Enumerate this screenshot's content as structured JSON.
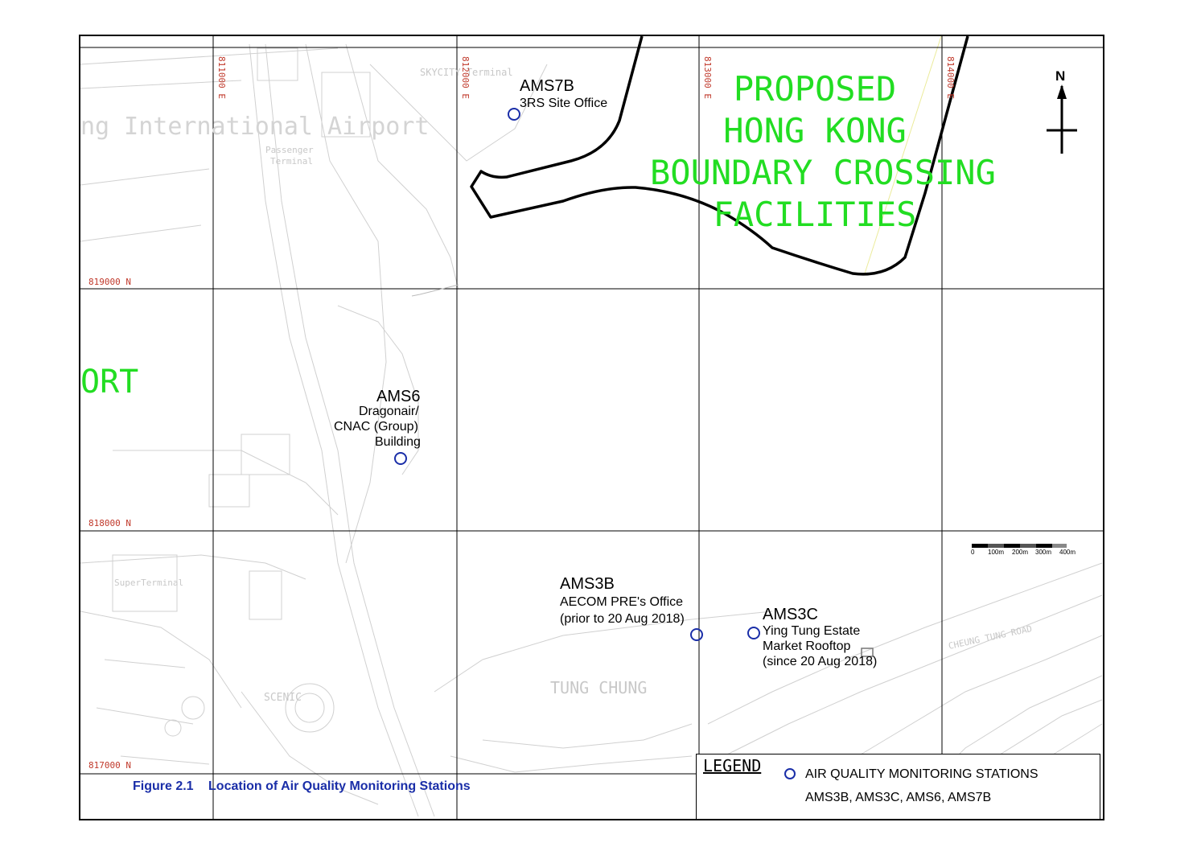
{
  "map": {
    "proposed_area": {
      "lines": [
        "PROPOSED",
        "HONG KONG",
        "BOUNDARY CROSSING",
        "FACILITIES"
      ]
    },
    "airport_fragment": "ORT",
    "north_arrow": {
      "label": "N",
      "icon": "north-arrow-icon"
    },
    "grid": {
      "eastings": [
        "811000 E",
        "812000 E",
        "813000 E",
        "814000 E"
      ],
      "northings": [
        "819000 N",
        "818000 N",
        "817000 N"
      ]
    },
    "stations": [
      {
        "id": "AMS7B",
        "name": "AMS7B",
        "desc": [
          "3RS Site Office"
        ]
      },
      {
        "id": "AMS6",
        "name": "AMS6",
        "desc": [
          "Dragonair/",
          "CNAC (Group)",
          "Building"
        ]
      },
      {
        "id": "AMS3B",
        "name": "AMS3B",
        "desc": [
          "AECOM PRE's Office",
          "(prior to 20 Aug 2018)"
        ]
      },
      {
        "id": "AMS3C",
        "name": "AMS3C",
        "desc": [
          "Ying Tung Estate",
          "Market Rooftop",
          "(since 20 Aug 2018)"
        ]
      }
    ],
    "scale": {
      "labels": [
        "0",
        "100m",
        "200m",
        "300m",
        "400m"
      ]
    },
    "background_text": {
      "terminal": "SKYCITY Terminal",
      "airport": "ng International Airport",
      "passenger": "Passenger",
      "terminal2": "Terminal",
      "super": "SuperTerminal",
      "tung_chung": "TUNG CHUNG",
      "cheung_tung_road": "CHEUNG TUNG ROAD",
      "scenic": "SCENIC"
    },
    "colors": {
      "station_marker": "#1a2ea8",
      "proposed_text": "#22dd22",
      "grid_label": "#c0392b",
      "caption": "#1a2ea8"
    }
  },
  "caption": {
    "figure": "Figure 2.1",
    "title": "Location of Air Quality Monitoring Stations"
  },
  "legend": {
    "title": "LEGEND",
    "item_label": "AIR QUALITY MONITORING STATIONS",
    "item_list": "AMS3B, AMS3C, AMS6, AMS7B"
  }
}
